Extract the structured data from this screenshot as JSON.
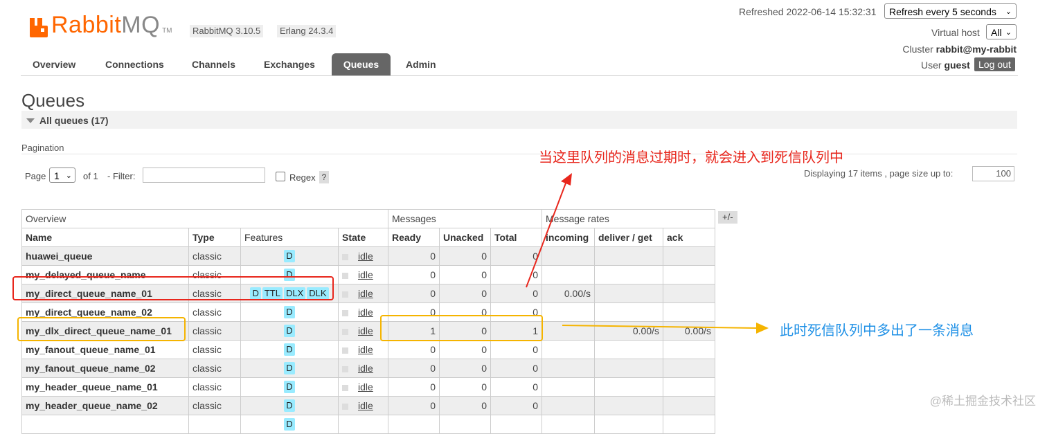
{
  "header": {
    "brand_part1": "Rabbit",
    "brand_part2": "MQ",
    "brand_tm": "TM",
    "version": "RabbitMQ 3.10.5",
    "erlang": "Erlang 24.3.4",
    "refreshed": "Refreshed 2022-06-14 15:32:31",
    "refresh_select": "Refresh every 5 seconds",
    "vhost_label": "Virtual host",
    "vhost_select": "All",
    "cluster_label": "Cluster",
    "cluster_value": "rabbit@my-rabbit",
    "user_label": "User",
    "user_value": "guest",
    "logout_label": "Log out",
    "logo_color": "#ff6600"
  },
  "nav": {
    "tabs": [
      "Overview",
      "Connections",
      "Channels",
      "Exchanges",
      "Queues",
      "Admin"
    ],
    "active": "Queues",
    "active_bg": "#666666"
  },
  "page": {
    "title": "Queues",
    "section": "All queues (17)",
    "pagination_label": "Pagination",
    "page_label": "Page",
    "page_value": "1",
    "of_label": "of 1",
    "filter_label": "- Filter:",
    "filter_value": "",
    "regex_label": "Regex",
    "help": "?",
    "displaying": "Displaying 17 items , page size up to:",
    "page_size": "100",
    "plus_minus": "+/-"
  },
  "table": {
    "groups": [
      "Overview",
      "Messages",
      "Message rates"
    ],
    "columns": [
      "Name",
      "Type",
      "Features",
      "State",
      "Ready",
      "Unacked",
      "Total",
      "incoming",
      "deliver / get",
      "ack"
    ],
    "rows": [
      {
        "name": "huawei_queue",
        "type": "classic",
        "features": [
          "D"
        ],
        "state": "idle",
        "ready": "0",
        "unacked": "0",
        "total": "0",
        "incoming": "",
        "deliver": "",
        "ack": ""
      },
      {
        "name": "my_delayed_queue_name",
        "type": "classic",
        "features": [
          "D"
        ],
        "state": "idle",
        "ready": "0",
        "unacked": "0",
        "total": "0",
        "incoming": "",
        "deliver": "",
        "ack": ""
      },
      {
        "name": "my_direct_queue_name_01",
        "type": "classic",
        "features": [
          "D",
          "TTL",
          "DLX",
          "DLK"
        ],
        "state": "idle",
        "ready": "0",
        "unacked": "0",
        "total": "0",
        "incoming": "0.00/s",
        "deliver": "",
        "ack": ""
      },
      {
        "name": "my_direct_queue_name_02",
        "type": "classic",
        "features": [
          "D"
        ],
        "state": "idle",
        "ready": "0",
        "unacked": "0",
        "total": "0",
        "incoming": "",
        "deliver": "",
        "ack": ""
      },
      {
        "name": "my_dlx_direct_queue_name_01",
        "type": "classic",
        "features": [
          "D"
        ],
        "state": "idle",
        "ready": "1",
        "unacked": "0",
        "total": "1",
        "incoming": "",
        "deliver": "0.00/s",
        "ack": "0.00/s"
      },
      {
        "name": "my_fanout_queue_name_01",
        "type": "classic",
        "features": [
          "D"
        ],
        "state": "idle",
        "ready": "0",
        "unacked": "0",
        "total": "0",
        "incoming": "",
        "deliver": "",
        "ack": ""
      },
      {
        "name": "my_fanout_queue_name_02",
        "type": "classic",
        "features": [
          "D"
        ],
        "state": "idle",
        "ready": "0",
        "unacked": "0",
        "total": "0",
        "incoming": "",
        "deliver": "",
        "ack": ""
      },
      {
        "name": "my_header_queue_name_01",
        "type": "classic",
        "features": [
          "D"
        ],
        "state": "idle",
        "ready": "0",
        "unacked": "0",
        "total": "0",
        "incoming": "",
        "deliver": "",
        "ack": ""
      },
      {
        "name": "my_header_queue_name_02",
        "type": "classic",
        "features": [
          "D"
        ],
        "state": "idle",
        "ready": "0",
        "unacked": "0",
        "total": "0",
        "incoming": "",
        "deliver": "",
        "ack": ""
      },
      {
        "name": "",
        "type": "",
        "features": [
          "D"
        ],
        "state": "",
        "ready": "",
        "unacked": "",
        "total": "",
        "incoming": "",
        "deliver": "",
        "ack": ""
      }
    ],
    "feature_color": "#99ebff"
  },
  "annotations": {
    "red_note": "当这里队列的消息过期时，就会进入到死信队列中",
    "orange_note": "此时死信队列中多出了一条消息",
    "red_color": "#e8261c",
    "orange_color": "#f5b400",
    "blue_text_color": "#1e90e6"
  },
  "watermark": "@稀土掘金技术社区"
}
